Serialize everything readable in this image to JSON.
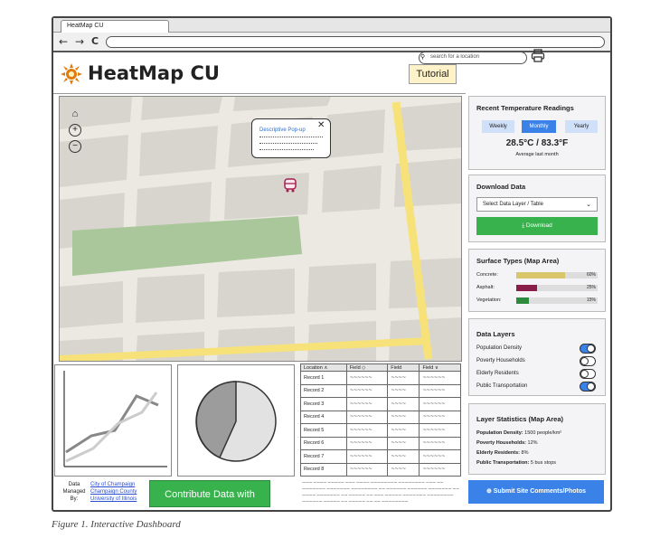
{
  "browser": {
    "tab_title": "HeatMap CU",
    "back": "←",
    "forward": "→",
    "reload": "C"
  },
  "header": {
    "app_title": "HeatMap CU",
    "tutorial_label": "Tutorial"
  },
  "search": {
    "placeholder": "search for a location"
  },
  "map": {
    "controls": [
      "home-icon",
      "zoom-in-icon",
      "zoom-out-icon"
    ],
    "popup": {
      "title": "Descriptive Pop-up",
      "close": "✕"
    },
    "colors": {
      "park": "#a9c79a",
      "highway": "#f7e27a",
      "blocks": "#d8d5cf",
      "roads": "#f4f2ee"
    }
  },
  "temperature": {
    "title": "Recent Temperature Readings",
    "tabs": [
      "Weekly",
      "Monthly",
      "Yearly"
    ],
    "active_tab": "Monthly",
    "value": "28.5°C / 83.3°F",
    "caption": "Average last month"
  },
  "download": {
    "title": "Download Data",
    "select_value": "Select Data Layer / Table",
    "button_label": "Download"
  },
  "surface": {
    "title": "Surface Types (Map Area)",
    "items": [
      {
        "label": "Concrete:",
        "pct": "60%",
        "fraction": 0.6,
        "color": "#d9c66a"
      },
      {
        "label": "Asphalt:",
        "pct": "25%",
        "fraction": 0.25,
        "color": "#8b1d4a"
      },
      {
        "label": "Vegetation:",
        "pct": "15%",
        "fraction": 0.15,
        "color": "#2e8b3d"
      }
    ]
  },
  "layers": {
    "title": "Data Layers",
    "items": [
      {
        "label": "Population Density",
        "on": true
      },
      {
        "label": "Poverty Households",
        "on": false
      },
      {
        "label": "Elderly Residents",
        "on": false
      },
      {
        "label": "Public Transportation",
        "on": true
      }
    ]
  },
  "stats": {
    "title": "Layer Statistics (Map Area)",
    "items": [
      {
        "key": "Population Density:",
        "value": "1500 people/km²"
      },
      {
        "key": "Poverty Households:",
        "value": "12%"
      },
      {
        "key": "Elderly Residents:",
        "value": "8%"
      },
      {
        "key": "Public Transportation:",
        "value": "5 bus stops"
      }
    ]
  },
  "table": {
    "headers": [
      "Location",
      "Field",
      "Field",
      "Field"
    ],
    "rows": [
      "Record 1",
      "Record 2",
      "Record 3",
      "Record 4",
      "Record 5",
      "Record 6",
      "Record 7",
      "Record 8"
    ]
  },
  "footer": {
    "data_managed_by": "Data Managed By:",
    "links": [
      "City of Champaign",
      "Champaign County",
      "University of Illinois"
    ],
    "qfield_label": "Contribute Data with QField",
    "submit_label": "Submit Site Comments/Photos"
  },
  "caption": "Figure 1. Interactive Dashboard"
}
